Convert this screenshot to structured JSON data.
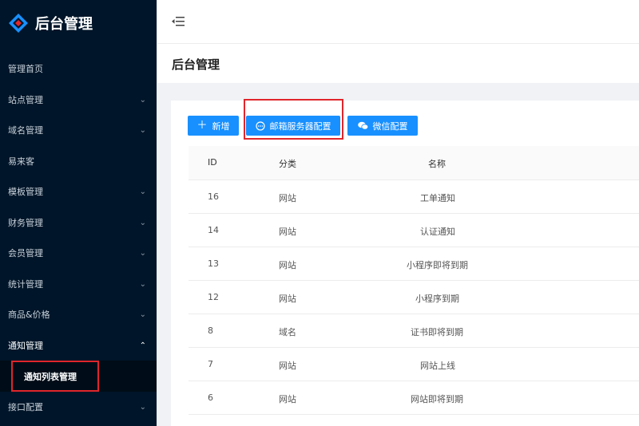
{
  "app": {
    "title": "后台管理"
  },
  "sidebar": {
    "items": [
      {
        "label": "管理首页",
        "has_children": false
      },
      {
        "label": "站点管理",
        "has_children": true
      },
      {
        "label": "域名管理",
        "has_children": true
      },
      {
        "label": "易来客",
        "has_children": false
      },
      {
        "label": "模板管理",
        "has_children": true
      },
      {
        "label": "财务管理",
        "has_children": true
      },
      {
        "label": "会员管理",
        "has_children": true
      },
      {
        "label": "统计管理",
        "has_children": true
      },
      {
        "label": "商品&价格",
        "has_children": true
      },
      {
        "label": "通知管理",
        "has_children": true,
        "open": true
      },
      {
        "label": "接口配置",
        "has_children": true
      }
    ],
    "submenu": {
      "label": "通知列表管理",
      "selected": true
    }
  },
  "page": {
    "title": "后台管理"
  },
  "toolbar": {
    "add_label": "新增",
    "mail_label": "邮箱服务器配置",
    "wechat_label": "微信配置"
  },
  "table": {
    "headers": {
      "id": "ID",
      "category": "分类",
      "name": "名称"
    },
    "rows": [
      {
        "id": "16",
        "category": "网站",
        "name": "工单通知"
      },
      {
        "id": "14",
        "category": "网站",
        "name": "认证通知"
      },
      {
        "id": "13",
        "category": "网站",
        "name": "小程序即将到期"
      },
      {
        "id": "12",
        "category": "网站",
        "name": "小程序到期"
      },
      {
        "id": "8",
        "category": "域名",
        "name": "证书即将到期"
      },
      {
        "id": "7",
        "category": "网站",
        "name": "网站上线"
      },
      {
        "id": "6",
        "category": "网站",
        "name": "网站即将到期"
      }
    ]
  },
  "colors": {
    "sidebar_bg": "#001529",
    "primary": "#1890ff",
    "highlight": "#e0262b"
  },
  "icons": {
    "logo": "diamond-logo-icon",
    "fold": "menu-fold-icon",
    "chevron": "chevron-down-icon",
    "add": "plus-icon",
    "mail": "message-icon",
    "wechat": "wechat-icon"
  }
}
